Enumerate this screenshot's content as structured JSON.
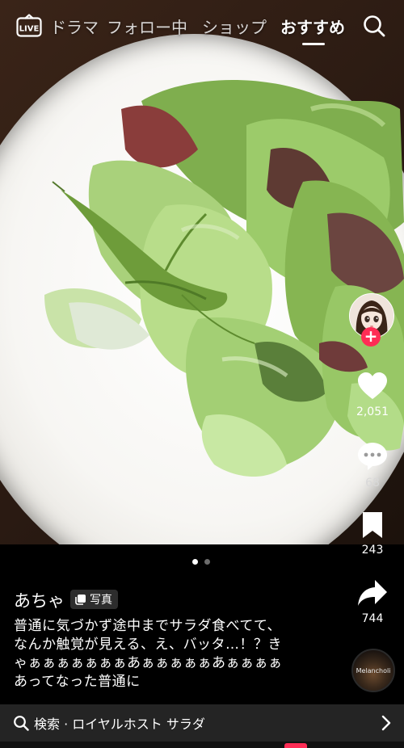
{
  "nav": {
    "live_label": "LIVE",
    "tabs": [
      {
        "label": "ドラマ"
      },
      {
        "label": "フォロー中"
      },
      {
        "label": "ショップ"
      },
      {
        "label": "おすすめ"
      }
    ],
    "active_tab": "おすすめ"
  },
  "actions": {
    "likes": "2,051",
    "comments": "68",
    "bookmarks": "243",
    "shares": "744"
  },
  "pagination": {
    "current": 1,
    "total": 2
  },
  "post": {
    "author": "あちゃ",
    "badge": "写真",
    "caption": "普通に気づかず途中までサラダ食べてて、なんか触覚が見える、え、バッタ…！？きゃぁぁぁぁぁぁぁあぁぁぁぁぁあぁぁぁぁあってなった普通に"
  },
  "music": {
    "disc_label": "Melancholi"
  },
  "search": {
    "text": "検索 · ロイヤルホスト サラダ"
  },
  "colors": {
    "accent": "#fe2c55",
    "background": "#000000",
    "searchbar": "#242424"
  }
}
